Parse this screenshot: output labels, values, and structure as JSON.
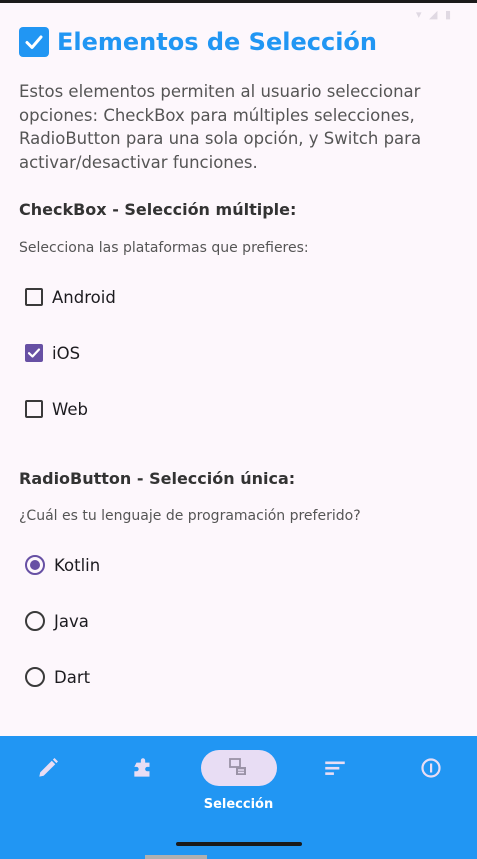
{
  "status": {
    "time": "",
    "icons": "▾ ◢ ▮"
  },
  "title": {
    "emoji": "☑️",
    "text": "Elementos de Selección"
  },
  "intro": "Estos elementos permiten al usuario seleccionar opciones: CheckBox para múltiples selecciones, RadioButton para una sola opción, y Switch para activar/desactivar funciones.",
  "checkbox_section": {
    "title": "CheckBox - Selección múltiple:",
    "subtitle": "Selecciona las plataformas que prefieres:",
    "options": [
      {
        "label": "Android",
        "checked": false
      },
      {
        "label": "iOS",
        "checked": true
      },
      {
        "label": "Web",
        "checked": false
      }
    ]
  },
  "radio_section": {
    "title": "RadioButton - Selección única:",
    "subtitle": "¿Cuál es tu lenguaje de programación preferido?",
    "options": [
      {
        "label": "Kotlin",
        "selected": true
      },
      {
        "label": "Java",
        "selected": false
      },
      {
        "label": "Dart",
        "selected": false
      }
    ]
  },
  "bottom_nav": {
    "items": [
      {
        "icon": "pencil-icon",
        "label": "",
        "active": false
      },
      {
        "icon": "extension-icon",
        "label": "",
        "active": false
      },
      {
        "icon": "selection-icon",
        "label": "Selección",
        "active": true
      },
      {
        "icon": "list-icon",
        "label": "",
        "active": false
      },
      {
        "icon": "info-icon",
        "label": "",
        "active": false
      }
    ]
  },
  "colors": {
    "accent": "#2196f3",
    "selection": "#6750a4",
    "background": "#fdf7fc",
    "nav_active_pill": "#e8ddf4"
  }
}
